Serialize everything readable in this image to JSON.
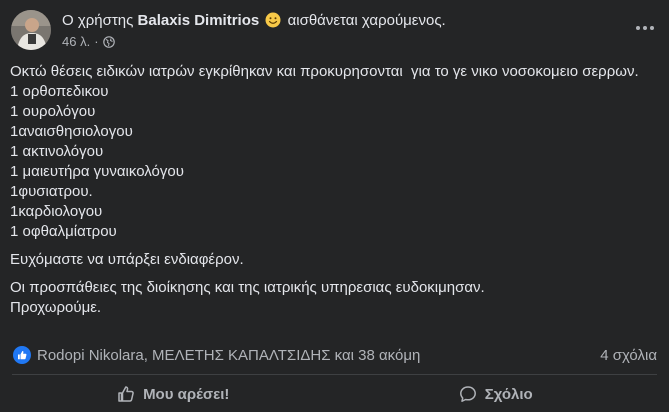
{
  "post": {
    "header": {
      "prefix": "Ο χρήστης",
      "author": "Balaxis Dimitrios",
      "feeling": "αισθάνεται χαρούμενος.",
      "time": "46 λ.",
      "separator": "·"
    },
    "body": {
      "intro": "Οκτώ θέσεις ειδικών ιατρών εγκρίθηκαν και προκυρησονται  για το γε νικο νοσοκομειο σερρων.",
      "positions": [
        "1 ορθοπεδικου",
        "1 ουρολόγου",
        "1αναισθησιολογου",
        "1 ακτινολόγου",
        "1 μαιευτήρα γυναικολόγου",
        "1φυσιατρου.",
        "1καρδιολογου",
        "1 οφθαλμίατρου"
      ],
      "wish": "Ευχόμαστε να υπάρξει ενδιαφέρον.",
      "closing_1": "Οι προσπάθειες της διοίκησης και της ιατρικής υπηρεσιας ευδοκιμησαν.",
      "closing_2": "Προχωρούμε."
    },
    "reactions": {
      "names": "Rodopi Nikolara, ΜΕΛΕΤΗΣ ΚΑΠΑΛΤΣΙΔΗΣ και 38 ακόμη",
      "comments": "4 σχόλια"
    },
    "actions": {
      "like": "Μου αρέσει!",
      "comment": "Σχόλιο"
    }
  },
  "colors": {
    "background": "#242526",
    "text": "#e4e6eb",
    "secondary": "#b0b3b8",
    "like_blue": "#2078f4"
  },
  "icons": [
    "avatar",
    "smile-emoji-icon",
    "globe-icon",
    "more-icon",
    "like-reaction-icon",
    "thumbs-up-icon",
    "comment-icon"
  ]
}
